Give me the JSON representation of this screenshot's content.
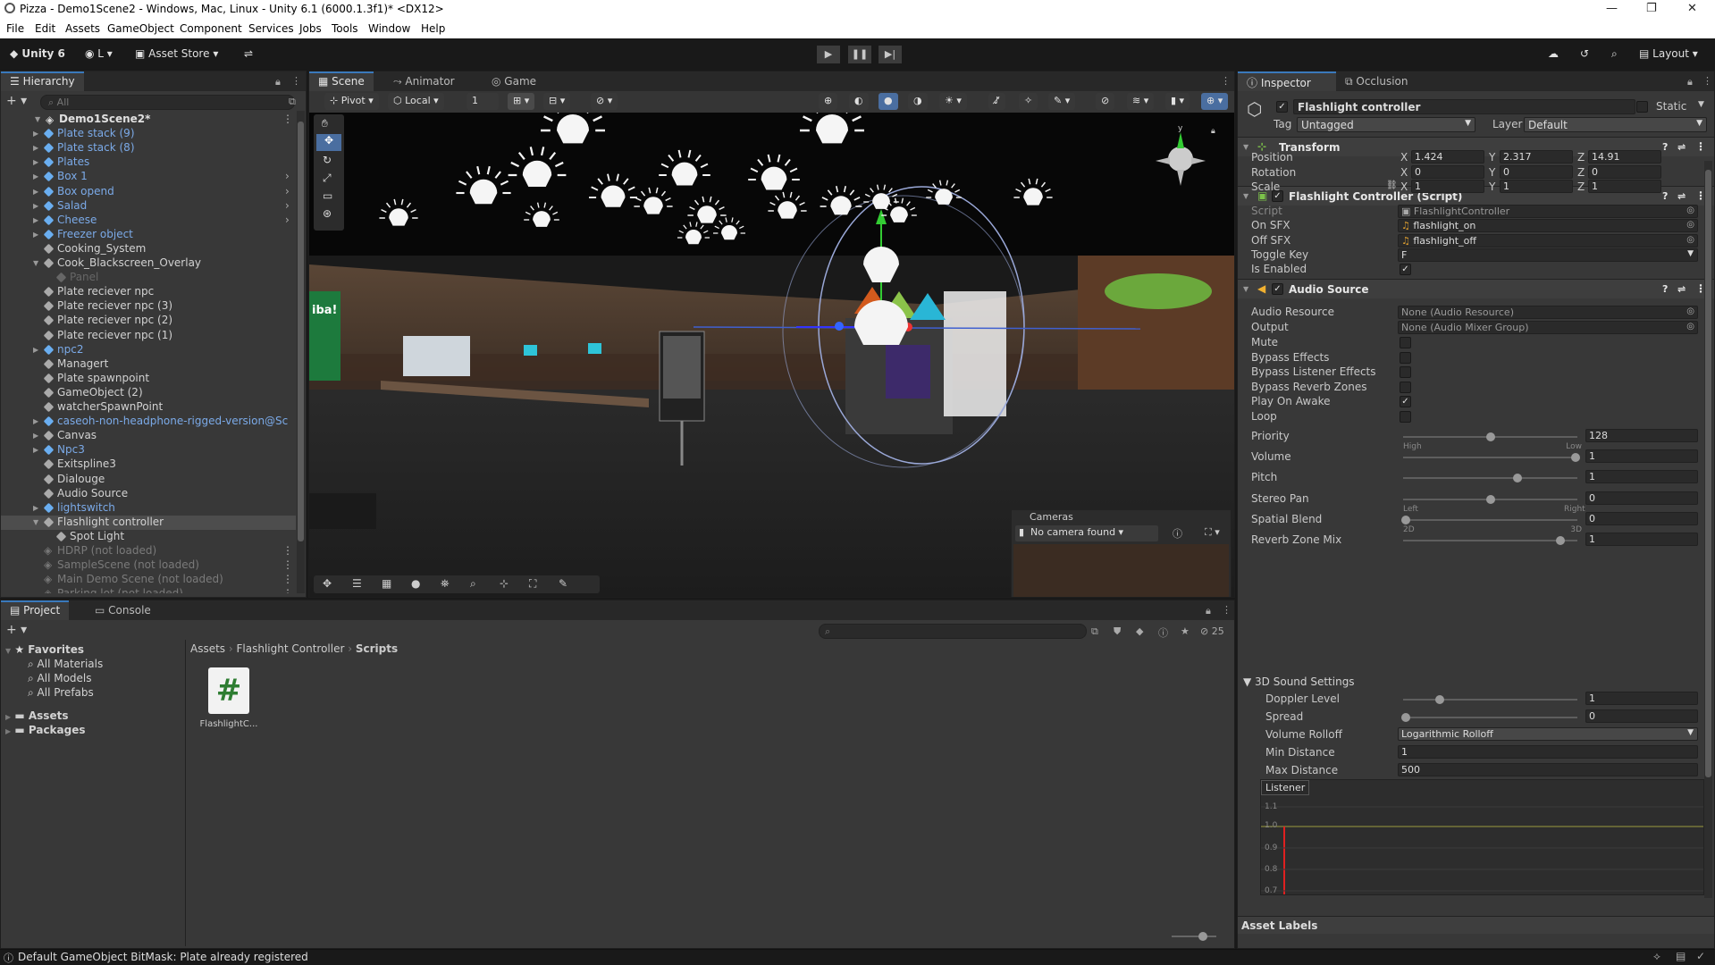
{
  "window": {
    "title": "Pizza - Demo1Scene2 - Windows, Mac, Linux - Unity 6.1 (6000.1.3f1)* <DX12>",
    "minimize": "—",
    "maximize": "❐",
    "close": "✕"
  },
  "menu": [
    "File",
    "Edit",
    "Assets",
    "GameObject",
    "Component",
    "Services",
    "Jobs",
    "Tools",
    "Window",
    "Help"
  ],
  "toolbar": {
    "unity_label": "Unity 6",
    "account_label": "L",
    "asset_store": "Asset Store",
    "layout": "Layout"
  },
  "hierarchy": {
    "tab": "Hierarchy",
    "search_placeholder": "All",
    "scene": "Demo1Scene2*",
    "items": [
      {
        "label": "Plate stack (9)",
        "style": "prefab",
        "indent": 1,
        "arrow": true
      },
      {
        "label": "Plate stack (8)",
        "style": "prefab",
        "indent": 1,
        "arrow": true
      },
      {
        "label": "Plates",
        "style": "prefab",
        "indent": 1,
        "arrow": true
      },
      {
        "label": "Box 1",
        "style": "prefab",
        "indent": 1,
        "arrow": true,
        "more": true
      },
      {
        "label": "Box opend",
        "style": "prefab",
        "indent": 1,
        "arrow": true,
        "more": true
      },
      {
        "label": "Salad",
        "style": "prefab",
        "indent": 1,
        "arrow": true,
        "more": true
      },
      {
        "label": "Cheese",
        "style": "prefab",
        "indent": 1,
        "arrow": true,
        "more": true
      },
      {
        "label": "Freezer object",
        "style": "prefab",
        "indent": 1,
        "arrow": true
      },
      {
        "label": "Cooking_System",
        "style": "normal",
        "indent": 1,
        "arrow": false
      },
      {
        "label": "Cook_Blackscreen_Overlay",
        "style": "normal",
        "indent": 1,
        "arrow": true,
        "open": true
      },
      {
        "label": "Panel",
        "style": "dim",
        "indent": 2,
        "arrow": false
      },
      {
        "label": "Plate reciever npc",
        "style": "normal",
        "indent": 1,
        "arrow": false
      },
      {
        "label": "Plate reciever npc (3)",
        "style": "normal",
        "indent": 1,
        "arrow": false
      },
      {
        "label": "Plate reciever npc (2)",
        "style": "normal",
        "indent": 1,
        "arrow": false
      },
      {
        "label": "Plate reciever npc (1)",
        "style": "normal",
        "indent": 1,
        "arrow": false
      },
      {
        "label": "npc2",
        "style": "prefab",
        "indent": 1,
        "arrow": true
      },
      {
        "label": "Managert",
        "style": "normal",
        "indent": 1,
        "arrow": false
      },
      {
        "label": "Plate spawnpoint",
        "style": "normal",
        "indent": 1,
        "arrow": false
      },
      {
        "label": "GameObject (2)",
        "style": "normal",
        "indent": 1,
        "arrow": false
      },
      {
        "label": "watcherSpawnPoint",
        "style": "normal",
        "indent": 1,
        "arrow": false
      },
      {
        "label": "caseoh-non-headphone-rigged-version@Sc",
        "style": "prefab",
        "indent": 1,
        "arrow": true
      },
      {
        "label": "Canvas",
        "style": "normal",
        "indent": 1,
        "arrow": true
      },
      {
        "label": "Npc3",
        "style": "prefab",
        "indent": 1,
        "arrow": true
      },
      {
        "label": "Exitspline3",
        "style": "normal",
        "indent": 1,
        "arrow": false
      },
      {
        "label": "Dialouge",
        "style": "normal",
        "indent": 1,
        "arrow": false
      },
      {
        "label": "Audio Source",
        "style": "normal",
        "indent": 1,
        "arrow": false
      },
      {
        "label": "lightswitch",
        "style": "prefab",
        "indent": 1,
        "arrow": true
      },
      {
        "label": "Flashlight controller",
        "style": "selected",
        "indent": 1,
        "arrow": true,
        "open": true
      },
      {
        "label": "Spot Light",
        "style": "normal",
        "indent": 2,
        "arrow": false
      }
    ],
    "unloaded": [
      "HDRP (not loaded)",
      "SampleScene (not loaded)",
      "Main Demo Scene (not loaded)",
      "Parking lot (not loaded)"
    ]
  },
  "scene_view": {
    "tabs": [
      "Scene",
      "Animator",
      "Game"
    ],
    "pivot": "Pivot",
    "local": "Local",
    "grid_value": "1",
    "cameras_overlay": {
      "title": "Cameras",
      "dropdown": "No camera found"
    },
    "sign_text": "iba!"
  },
  "inspector": {
    "tabs": [
      "Inspector",
      "Occlusion"
    ],
    "object_name": "Flashlight controller",
    "static_label": "Static",
    "tag_label": "Tag",
    "tag_value": "Untagged",
    "layer_label": "Layer",
    "layer_value": "Default",
    "transform": {
      "title": "Transform",
      "position": {
        "label": "Position",
        "x": "1.424",
        "y": "2.317",
        "z": "14.91"
      },
      "rotation": {
        "label": "Rotation",
        "x": "0",
        "y": "0",
        "z": "0"
      },
      "scale": {
        "label": "Scale",
        "x": "1",
        "y": "1",
        "z": "1"
      }
    },
    "script_component": {
      "title": "Flashlight Controller (Script)",
      "fields": [
        {
          "label": "Script",
          "value": "FlashlightController"
        },
        {
          "label": "On SFX",
          "value": "flashlight_on"
        },
        {
          "label": "Off SFX",
          "value": "flashlight_off"
        },
        {
          "label": "Toggle Key",
          "value": "F"
        },
        {
          "label": "Is Enabled",
          "value": "✓"
        }
      ]
    },
    "audio_source": {
      "title": "Audio Source",
      "audio_resource": {
        "label": "Audio Resource",
        "value": "None (Audio Resource)"
      },
      "output": {
        "label": "Output",
        "value": "None (Audio Mixer Group)"
      },
      "checks": [
        {
          "label": "Mute",
          "checked": false
        },
        {
          "label": "Bypass Effects",
          "checked": false
        },
        {
          "label": "Bypass Listener Effects",
          "checked": false
        },
        {
          "label": "Bypass Reverb Zones",
          "checked": false
        },
        {
          "label": "Play On Awake",
          "checked": true
        },
        {
          "label": "Loop",
          "checked": false
        }
      ],
      "sliders": [
        {
          "label": "Priority",
          "value": "128",
          "fraction": 0.5,
          "left": "High",
          "right": "Low"
        },
        {
          "label": "Volume",
          "value": "1",
          "fraction": 1.0
        },
        {
          "label": "Pitch",
          "value": "1",
          "fraction": 0.66
        },
        {
          "label": "Stereo Pan",
          "value": "0",
          "fraction": 0.5,
          "left": "Left",
          "right": "Right"
        },
        {
          "label": "Spatial Blend",
          "value": "0",
          "fraction": 0.0,
          "left": "2D",
          "right": "3D"
        },
        {
          "label": "Reverb Zone Mix",
          "value": "1",
          "fraction": 0.91
        }
      ],
      "sound3d": {
        "title": "3D Sound Settings",
        "doppler": {
          "label": "Doppler Level",
          "value": "1",
          "fraction": 0.2
        },
        "spread": {
          "label": "Spread",
          "value": "0",
          "fraction": 0.0
        },
        "rolloff": {
          "label": "Volume Rolloff",
          "value": "Logarithmic Rolloff"
        },
        "min_distance": {
          "label": "Min Distance",
          "value": "1"
        },
        "max_distance": {
          "label": "Max Distance",
          "value": "500"
        }
      },
      "graph": {
        "legend": "Listener",
        "ticks": [
          "1.1",
          "1.0",
          "0.9",
          "0.8",
          "0.7"
        ]
      }
    },
    "asset_labels": "Asset Labels"
  },
  "project": {
    "tabs": [
      "Project",
      "Console"
    ],
    "favorites_title": "Favorites",
    "favorites": [
      "All Materials",
      "All Models",
      "All Prefabs"
    ],
    "roots": [
      "Assets",
      "Packages"
    ],
    "breadcrumb": [
      "Assets",
      "Flashlight Controller",
      "Scripts"
    ],
    "files": [
      {
        "name": "FlashlightC...",
        "icon": "#"
      }
    ],
    "hidden_count": "25"
  },
  "status": {
    "message": "Default GameObject BitMask: Plate already registered"
  },
  "colors": {
    "accent": "#3a79bb",
    "prefab": "#7baae8",
    "selected": "#4d4d4d",
    "panel": "#383838",
    "header": "#282828"
  }
}
